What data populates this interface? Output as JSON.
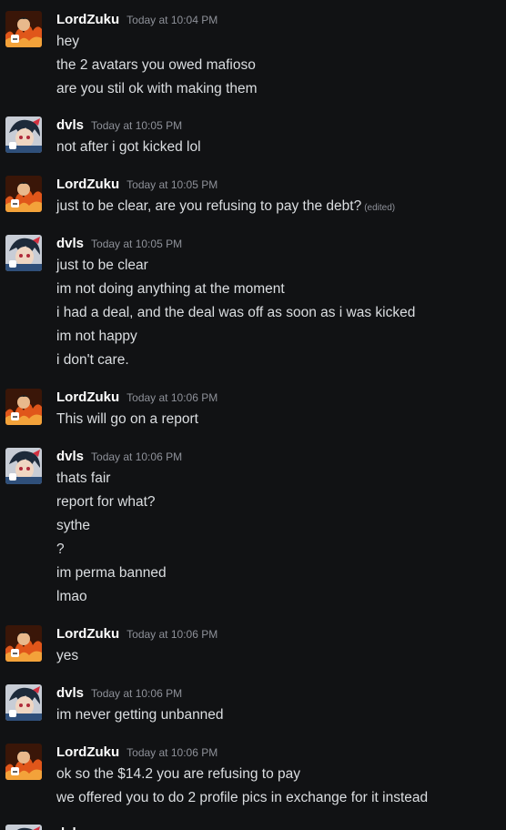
{
  "chat": {
    "groups": [
      {
        "author": "LordZuku",
        "avatar": "fire-character-avatar",
        "time": "Today at 10:04 PM",
        "lines": [
          "hey",
          "the 2 avatars you owed mafioso",
          "are you stil ok with making them"
        ]
      },
      {
        "author": "dvls",
        "avatar": "anime-character-avatar",
        "time": "Today at 10:05 PM",
        "lines": [
          "not after i got kicked lol"
        ]
      },
      {
        "author": "LordZuku",
        "avatar": "fire-character-avatar",
        "time": "Today at 10:05 PM",
        "lines": [
          "just to be clear, are you refusing to pay the debt?"
        ],
        "edited": "(edited)"
      },
      {
        "author": "dvls",
        "avatar": "anime-character-avatar",
        "time": "Today at 10:05 PM",
        "lines": [
          "just to be clear",
          "im not doing anything at the moment",
          "i had a deal, and the deal was off as soon as i was kicked",
          "im not happy",
          "i don't care."
        ]
      },
      {
        "author": "LordZuku",
        "avatar": "fire-character-avatar",
        "time": "Today at 10:06 PM",
        "lines": [
          "This will go on a report"
        ]
      },
      {
        "author": "dvls",
        "avatar": "anime-character-avatar",
        "time": "Today at 10:06 PM",
        "lines": [
          "thats fair",
          "report for what?",
          "sythe",
          "?",
          "im perma banned",
          "lmao"
        ]
      },
      {
        "author": "LordZuku",
        "avatar": "fire-character-avatar",
        "time": "Today at 10:06 PM",
        "lines": [
          "yes"
        ]
      },
      {
        "author": "dvls",
        "avatar": "anime-character-avatar",
        "time": "Today at 10:06 PM",
        "lines": [
          "im never getting unbanned"
        ]
      },
      {
        "author": "LordZuku",
        "avatar": "fire-character-avatar",
        "time": "Today at 10:06 PM",
        "lines": [
          "ok so the $14.2 you are refusing to pay",
          "we offered you to do 2 profile pics in exchange for it instead"
        ]
      },
      {
        "author": "dvls",
        "avatar": "anime-character-avatar",
        "time": "",
        "lines": []
      }
    ]
  }
}
